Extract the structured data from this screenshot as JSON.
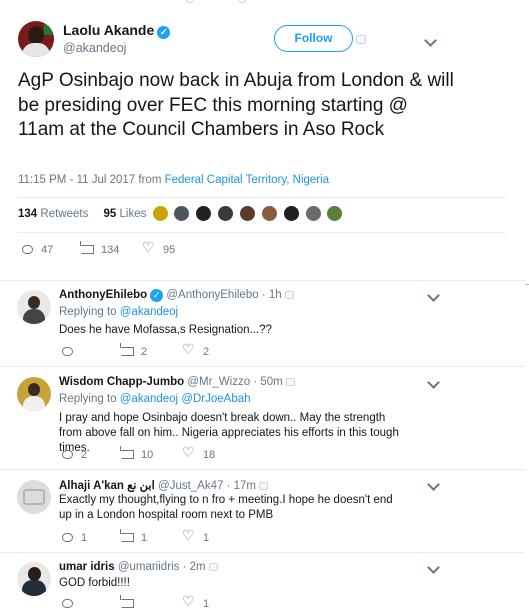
{
  "top_counts": [
    "",
    ""
  ],
  "tweet": {
    "author_name": "Laolu Akande",
    "author_handle": "@akandeoj",
    "follow_label": "Follow",
    "text": "AgP Osinbajo now back in Abuja from London & will be presiding over FEC this morning starting @ 11am at the Council Chambers in Aso Rock",
    "time": "11:15 PM - 11 Jul 2017",
    "from_label": "from",
    "location": "Federal Capital Territory, Nigeria",
    "retweets_count": "134",
    "retweets_label": "Retweets",
    "likes_count": "95",
    "likes_label": "Likes",
    "reply_count": "47",
    "retweet_count": "134",
    "like_count": "95"
  },
  "replies": [
    {
      "name": "AnthonyEhilebo",
      "handle": "@AnthonyEhilebo",
      "time": "1h",
      "replying_label": "Replying to",
      "replying_to": "@akandeoj",
      "replying_to_2": "",
      "text": "Does he have Mofassa,s Resignation...??",
      "reply_count": "",
      "retweet_count": "2",
      "like_count": "2"
    },
    {
      "name": "Wisdom Chapp-Jumbo",
      "handle": "@Mr_Wizzo",
      "time": "50m",
      "replying_label": "Replying to",
      "replying_to": "@akandeoj",
      "replying_to_2": "@DrJoeAbah",
      "text": "I pray and hope Osinbajo doesn't break down.. May the strength from above fall on him.. Nigeria appreciates his efforts in this tough times.",
      "reply_count": "2",
      "retweet_count": "10",
      "like_count": "18"
    },
    {
      "name": "Alhaji A'kan ابن نع",
      "handle": "@Just_Ak47",
      "time": "17m",
      "text": "Exactly my thought,flying to n fro + meeting.I hope he doesn't end up in a London hospital room next to PMB",
      "reply_count": "1",
      "retweet_count": "1",
      "like_count": "1"
    },
    {
      "name": "umar idris",
      "handle": "@umariidris",
      "time": "2m",
      "text": "GOD forbid!!!!",
      "reply_count": "",
      "retweet_count": "",
      "like_count": "1"
    }
  ],
  "colors": {
    "accent": "#1da1f2",
    "link": "#1b95e0",
    "muted": "#657786",
    "divider": "#e6ecf0"
  },
  "icons": [
    "verified-icon",
    "reply-icon",
    "retweet-icon",
    "like-icon",
    "chevron-down-icon",
    "dm-icon"
  ]
}
